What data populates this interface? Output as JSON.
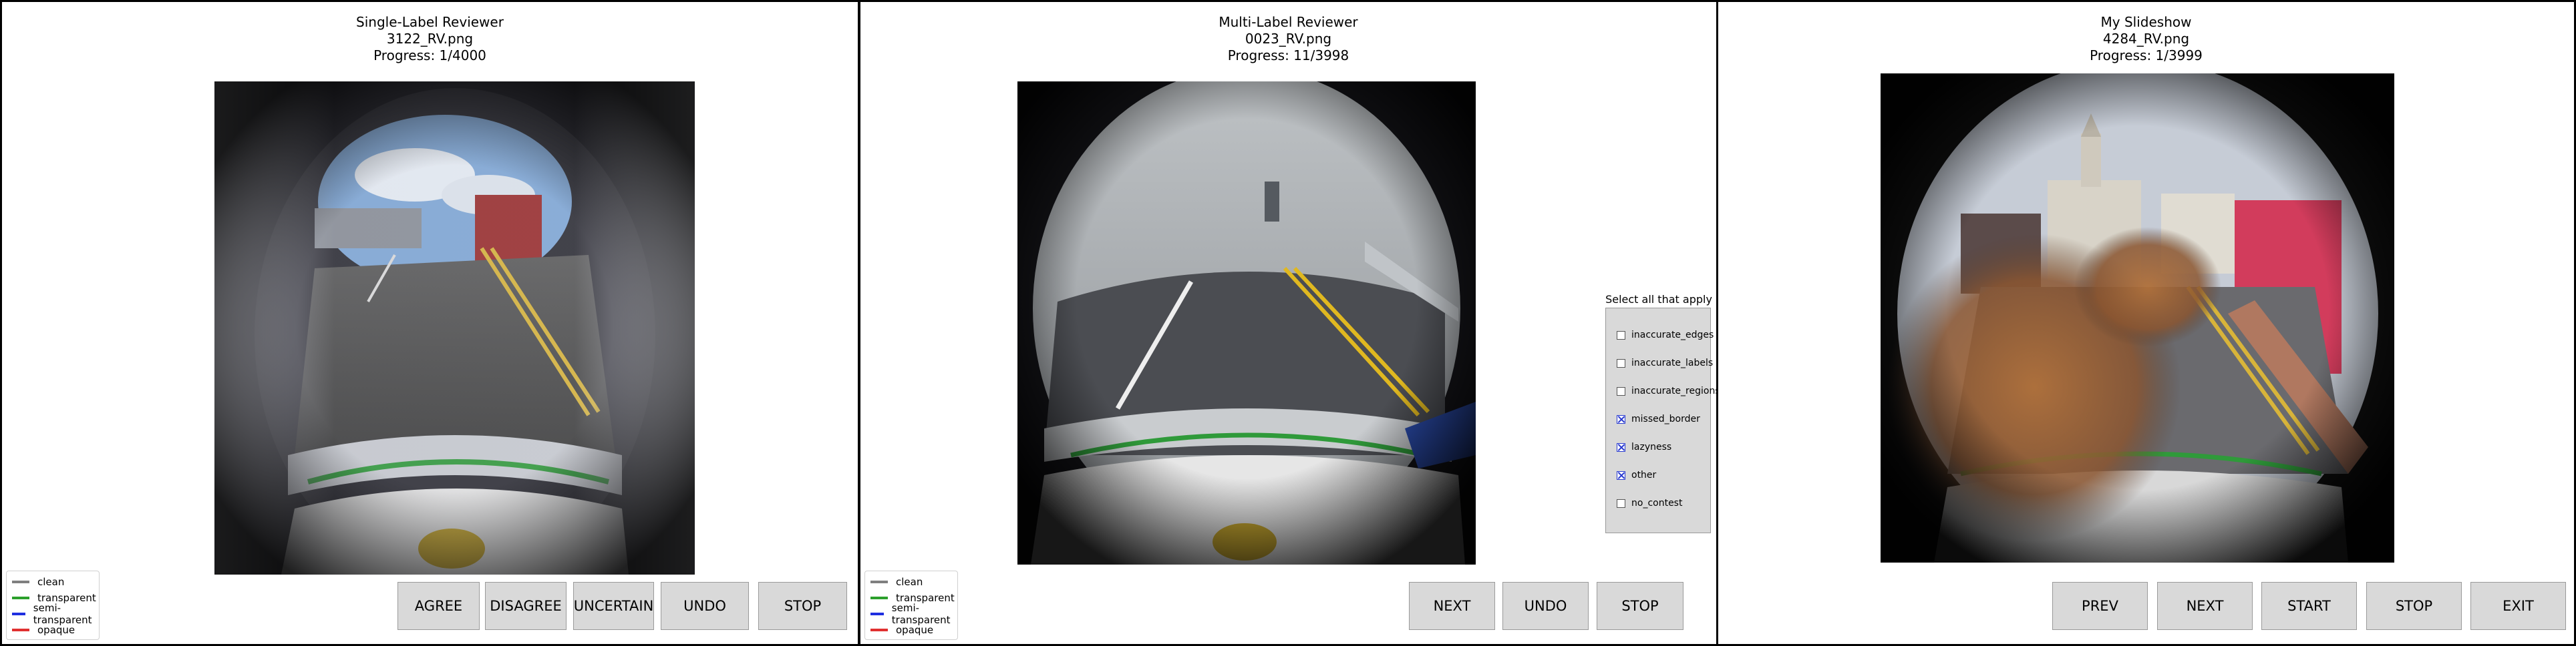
{
  "panels": [
    {
      "title": "Single-Label Reviewer",
      "filename": "3122_RV.png",
      "progress": "Progress: 1/4000",
      "buttons": [
        "AGREE",
        "DISAGREE",
        "UNCERTAIN",
        "UNDO",
        "STOP"
      ]
    },
    {
      "title": "Multi-Label Reviewer",
      "filename": "0023_RV.png",
      "progress": "Progress: 11/3998",
      "buttons": [
        "NEXT",
        "UNDO",
        "STOP"
      ],
      "checklist": {
        "title": "Select all that apply",
        "items": [
          {
            "label": "inaccurate_edges",
            "checked": false
          },
          {
            "label": "inaccurate_labels",
            "checked": false
          },
          {
            "label": "inaccurate_regions",
            "checked": false
          },
          {
            "label": "missed_border",
            "checked": true
          },
          {
            "label": "lazyness",
            "checked": true
          },
          {
            "label": "other",
            "checked": true
          },
          {
            "label": "no_contest",
            "checked": false
          }
        ]
      }
    },
    {
      "title": "My Slideshow",
      "filename": "4284_RV.png",
      "progress": "Progress: 1/3999",
      "buttons": [
        "PREV",
        "NEXT",
        "START",
        "STOP",
        "EXIT"
      ]
    }
  ],
  "legend": [
    {
      "label": "clean",
      "color": "#7f7f7f"
    },
    {
      "label": "transparent",
      "color": "#2ca02c"
    },
    {
      "label": "semi-transparent",
      "color": "#1f2fe0"
    },
    {
      "label": "opaque",
      "color": "#e03030"
    }
  ]
}
